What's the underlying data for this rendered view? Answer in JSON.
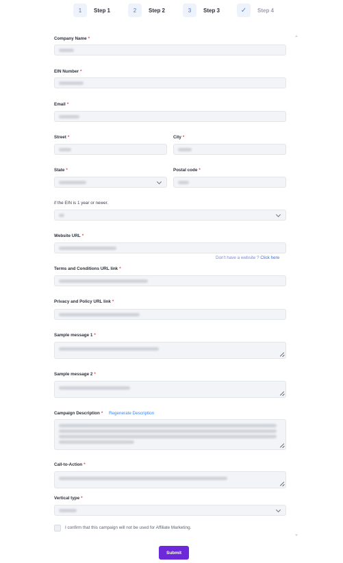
{
  "stepper": {
    "steps": [
      {
        "number": "1",
        "label": "Step 1"
      },
      {
        "number": "2",
        "label": "Step 2"
      },
      {
        "number": "3",
        "label": "Step 3"
      },
      {
        "number": "✓",
        "label": "Step 4"
      }
    ]
  },
  "form": {
    "company_name": {
      "label": "Company Name",
      "required": "*"
    },
    "ein_number": {
      "label": "EIN Number",
      "required": "*"
    },
    "email": {
      "label": "Email",
      "required": "*"
    },
    "street": {
      "label": "Street",
      "required": "*"
    },
    "city": {
      "label": "City",
      "required": "*"
    },
    "state": {
      "label": "State",
      "required": "*"
    },
    "postal_code": {
      "label": "Postal code",
      "required": "*"
    },
    "ein_age": {
      "label": "if the EIN is 1 year or newer."
    },
    "website_url": {
      "label": "Website URL",
      "required": "*"
    },
    "website_help": {
      "text": "Don't have a website ?",
      "link": "Click here"
    },
    "terms_url": {
      "label": "Terms and Conditions URL link",
      "required": "*"
    },
    "privacy_url": {
      "label": "Privacy and Policy URL link",
      "required": "*"
    },
    "sample_message_1": {
      "label": "Sample message 1",
      "required": "*"
    },
    "sample_message_2": {
      "label": "Sample message 2",
      "required": "*"
    },
    "campaign_description": {
      "label": "Campaign Description",
      "required": "*",
      "regenerate": "Regenerate Description"
    },
    "call_to_action": {
      "label": "Call-to-Action",
      "required": "*"
    },
    "vertical_type": {
      "label": "Vertical type",
      "required": "*"
    },
    "confirm_text": "I confirm that this campaign will not be used for Affiliate Marketing.",
    "submit_label": "Submit"
  },
  "colors": {
    "accent": "#6d28d9",
    "required": "#e5484d",
    "link": "#3b82f6",
    "input_bg": "#f3f4f7"
  }
}
